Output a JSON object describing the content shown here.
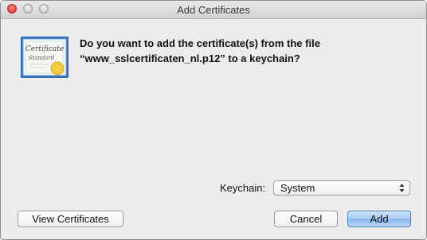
{
  "window": {
    "title": "Add Certificates"
  },
  "icon": {
    "name": "certificate-icon",
    "seal_color": "#f3d24b",
    "accent": "#2f6fc0"
  },
  "message": {
    "line1": "Do you want to add the certificate(s) from the file",
    "line2": "“www_sslcertificaten_nl.p12” to a keychain?"
  },
  "keychain": {
    "label": "Keychain:",
    "selected": "System"
  },
  "buttons": {
    "view_certificates": "View Certificates",
    "cancel": "Cancel",
    "add": "Add"
  }
}
